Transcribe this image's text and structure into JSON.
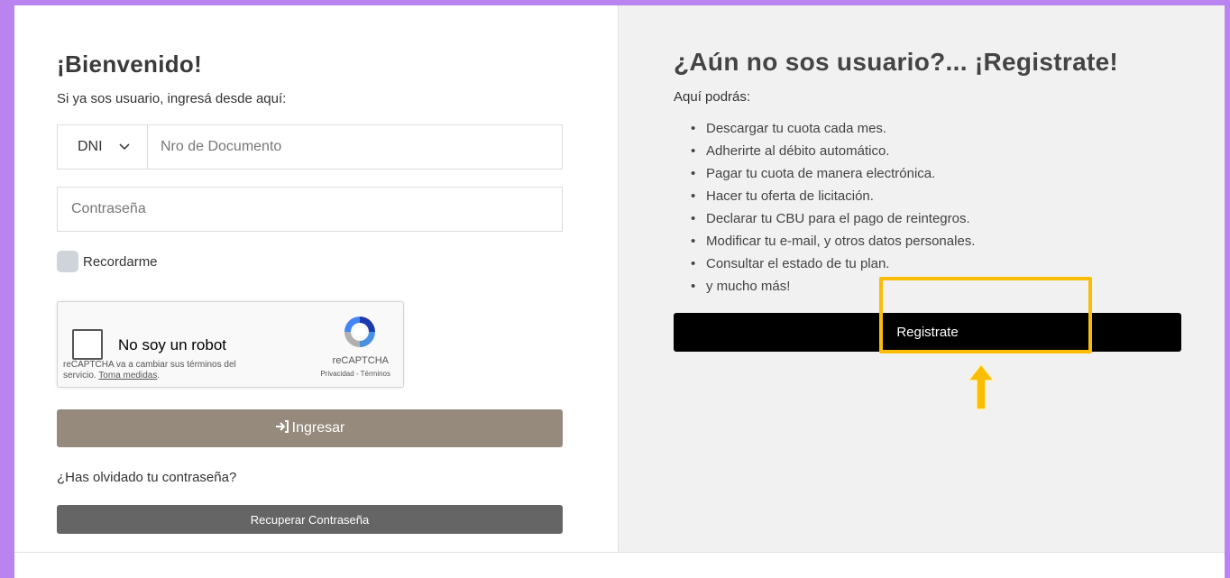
{
  "login": {
    "title": "¡Bienvenido!",
    "subtitle": "Si ya sos usuario, ingresá desde aquí:",
    "doc_type": "DNI",
    "doc_placeholder": "Nro de Documento",
    "password_placeholder": "Contraseña",
    "remember_label": "Recordarme",
    "login_button": "Ingresar",
    "forgot_text": "¿Has olvidado tu contraseña?",
    "recover_button": "Recuperar Contraseña"
  },
  "captcha": {
    "label": "No soy un robot",
    "notice_text": "reCAPTCHA va a cambiar sus términos del servicio.",
    "notice_link": "Toma medidas",
    "brand": "reCAPTCHA",
    "privacy": "Privacidad",
    "terms": "Términos"
  },
  "register": {
    "title": "¿Aún no sos usuario?... ¡Registrate!",
    "subtitle": "Aquí podrás:",
    "benefits": [
      "Descargar tu cuota cada mes.",
      "Adherirte al débito automático.",
      "Pagar tu cuota de manera electrónica.",
      "Hacer tu oferta de licitación.",
      "Declarar tu CBU para el pago de reintegros.",
      "Modificar tu e-mail, y otros datos personales.",
      "Consultar el estado de tu plan.",
      "y mucho más!"
    ],
    "button": "Registrate"
  },
  "colors": {
    "page_border": "#b983f0",
    "login_button": "#968a7d",
    "recover_button": "#656565",
    "register_button": "#000000",
    "highlight": "#fbbc05"
  },
  "icons": {
    "login": "sign-in-icon",
    "captcha": "recaptcha-logo-icon",
    "select": "chevron-down-icon",
    "annotation": "arrow-up-icon"
  }
}
